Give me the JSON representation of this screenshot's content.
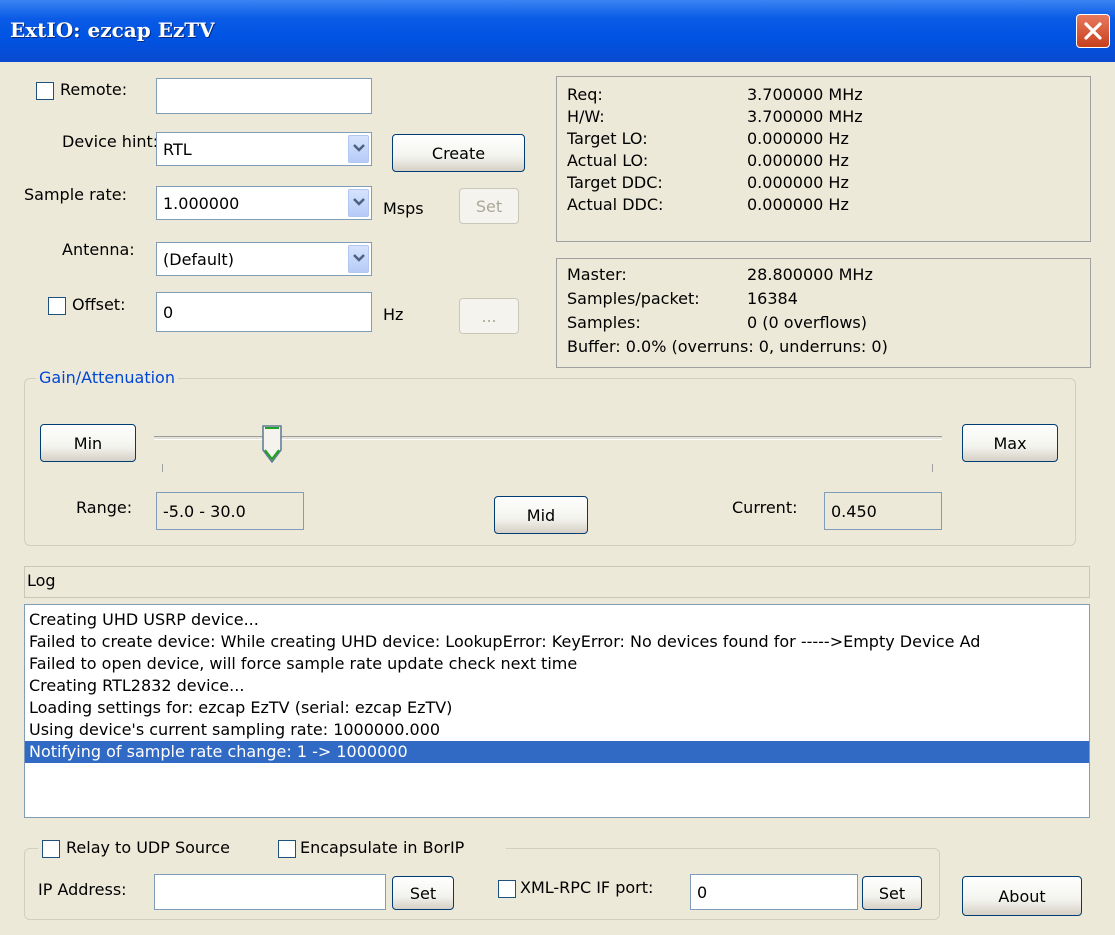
{
  "window": {
    "title": "ExtIO: ezcap EzTV"
  },
  "device": {
    "remote_label": "Remote:",
    "remote_value": "",
    "device_hint_label": "Device hint:",
    "device_hint_value": "RTL",
    "create_label": "Create",
    "sample_rate_label": "Sample rate:",
    "sample_rate_value": "1.000000",
    "sample_rate_unit": "Msps",
    "set_label": "Set",
    "antenna_label": "Antenna:",
    "antenna_value": "(Default)",
    "offset_label": "Offset:",
    "offset_value": "0",
    "offset_unit": "Hz",
    "ellipsis_label": "..."
  },
  "freq_panel": {
    "rows": [
      {
        "label": "Req:",
        "value": "3.700000 MHz"
      },
      {
        "label": "H/W:",
        "value": "3.700000 MHz"
      },
      {
        "label": "Target LO:",
        "value": "0.000000 Hz"
      },
      {
        "label": "Actual LO:",
        "value": "0.000000 Hz"
      },
      {
        "label": "Target DDC:",
        "value": "0.000000 Hz"
      },
      {
        "label": "Actual DDC:",
        "value": "0.000000 Hz"
      }
    ]
  },
  "stats_panel": {
    "master_label": "Master:",
    "master_value": "28.800000 MHz",
    "spp_label": "Samples/packet:",
    "spp_value": "16384",
    "samples_label": "Samples:",
    "samples_value": "0 (0 overflows)",
    "buffer_text": "Buffer: 0.0% (overruns: 0, underruns: 0)"
  },
  "gain": {
    "group_label": "Gain/Attenuation",
    "min_label": "Min",
    "max_label": "Max",
    "mid_label": "Mid",
    "range_label": "Range:",
    "range_value": "-5.0 - 30.0",
    "current_label": "Current:",
    "current_value": "0.450",
    "slider_fraction": 0.15
  },
  "log": {
    "header": "Log",
    "lines": [
      "Creating UHD USRP device...",
      "Failed to create device: While creating UHD device: LookupError: KeyError: No devices found for ----->Empty Device Ad",
      "Failed to open device, will force sample rate update check next time",
      "Creating RTL2832 device...",
      "Loading settings for: ezcap EzTV (serial: ezcap EzTV)",
      "Using device's current sampling rate: 1000000.000",
      "Notifying of sample rate change: 1 -> 1000000"
    ],
    "selected_index": 6
  },
  "network": {
    "relay_label": "Relay to UDP Source",
    "encapsulate_label": "Encapsulate in BorIP",
    "ip_label": "IP Address:",
    "ip_value": "",
    "ip_set_label": "Set",
    "xmlrpc_label": "XML-RPC IF port:",
    "xmlrpc_value": "0",
    "xmlrpc_set_label": "Set",
    "about_label": "About"
  }
}
